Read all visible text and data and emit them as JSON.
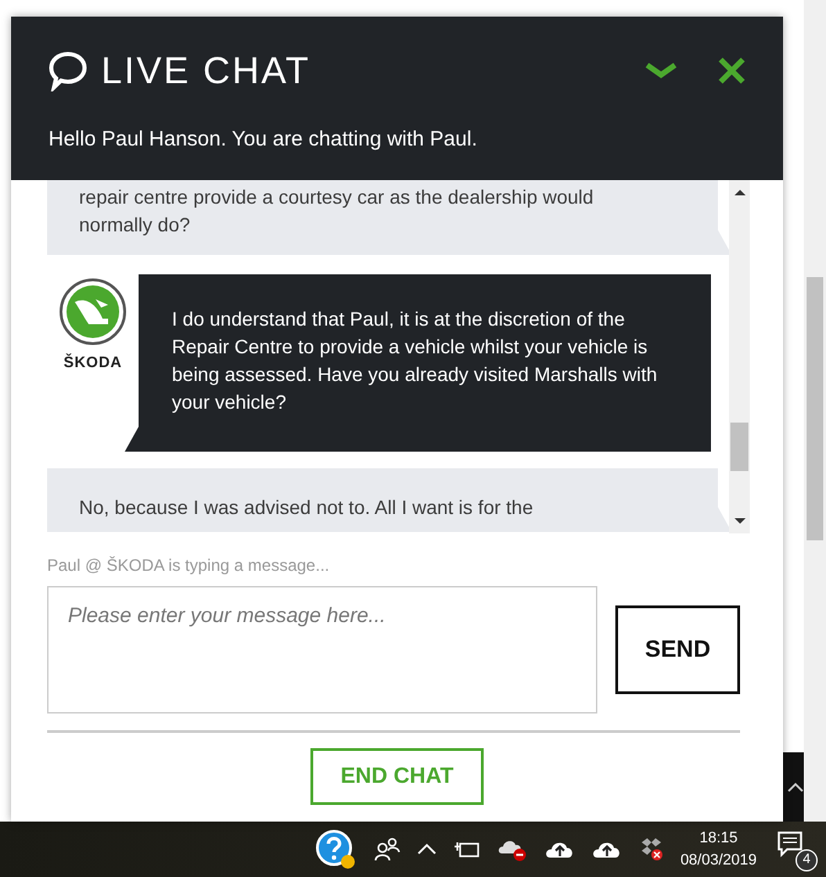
{
  "chat": {
    "title": "LIVE CHAT",
    "greeting": "Hello Paul Hanson. You are chatting with Paul.",
    "messages": [
      {
        "kind": "customer",
        "text": "repair centre provide a courtesy car as the dealership would normally do?"
      },
      {
        "kind": "agent",
        "logo_text": "ŠKODA",
        "text": "I do understand that Paul, it is at the discretion of the Repair Centre to provide a vehicle whilst your vehicle is being assessed. Have you already visited Marshalls with your vehicle?"
      },
      {
        "kind": "customer",
        "text": "No, because I was advised not to. All I want is for the"
      }
    ],
    "typing_status": "Paul @ ŠKODA is typing a message...",
    "input": {
      "placeholder": "Please enter your message here..."
    },
    "send_button": "SEND",
    "end_button": "END CHAT"
  },
  "taskbar": {
    "time": "18:15",
    "date": "08/03/2019",
    "notification_count": "4"
  }
}
